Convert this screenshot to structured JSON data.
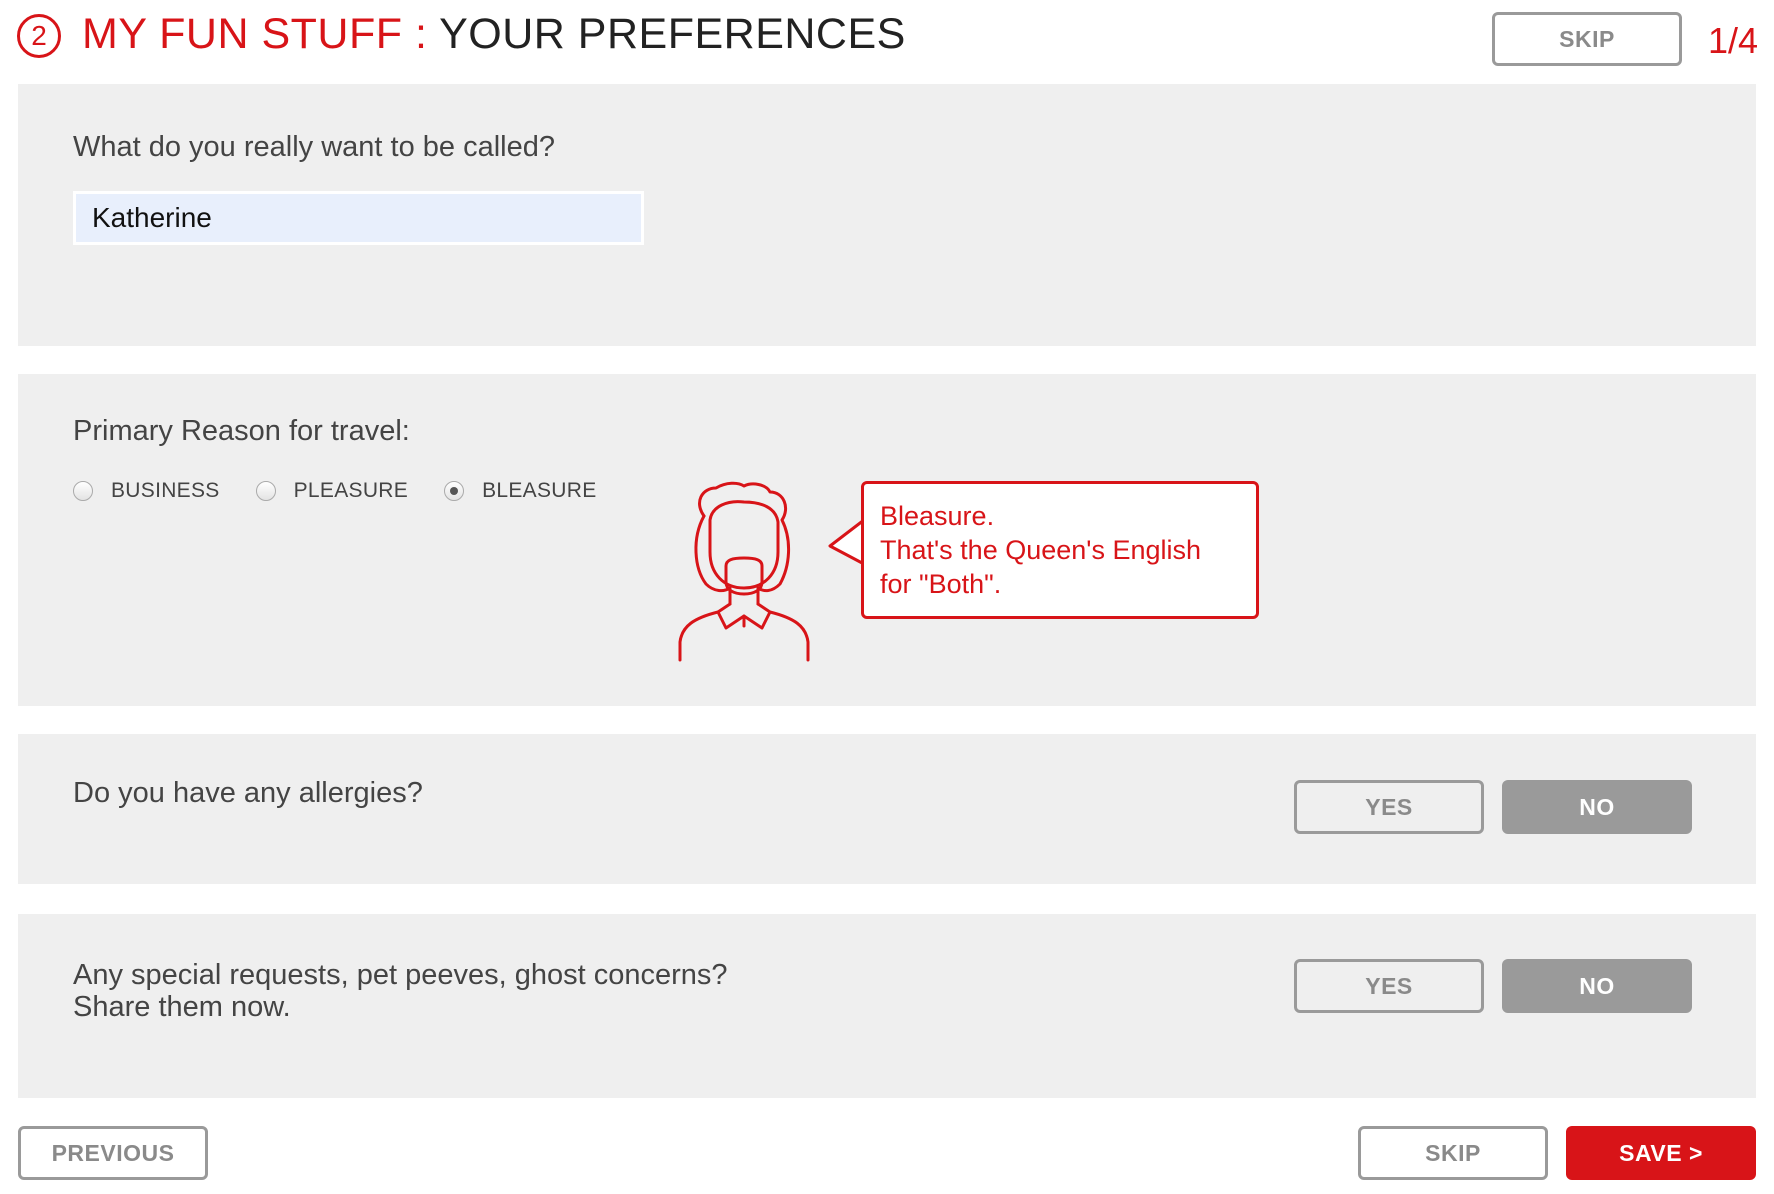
{
  "header": {
    "step_number": "2",
    "title_section": "MY FUN STUFF :",
    "title_page": "YOUR PREFERENCES",
    "skip_label": "SKIP",
    "page_count": "1/4"
  },
  "name_question": {
    "label": "What do you really want to be called?",
    "value": "Katherine"
  },
  "travel_reason": {
    "label": "Primary Reason for travel:",
    "options": [
      {
        "label": "BUSINESS",
        "selected": false
      },
      {
        "label": "PLEASURE",
        "selected": false
      },
      {
        "label": "BLEASURE",
        "selected": true
      }
    ],
    "bubble": {
      "line1": "Bleasure.",
      "line2": "That's the Queen's English",
      "line3": "for \"Both\"."
    }
  },
  "allergies": {
    "label": "Do you have any allergies?",
    "yes_label": "YES",
    "no_label": "NO",
    "selected": "NO"
  },
  "special_requests": {
    "line1": "Any special requests, pet peeves, ghost concerns?",
    "line2": "Share them now.",
    "yes_label": "YES",
    "no_label": "NO",
    "selected": "NO"
  },
  "footer": {
    "previous_label": "PREVIOUS",
    "skip_label": "SKIP",
    "save_label": "SAVE >"
  },
  "colors": {
    "accent_red": "#d81418",
    "panel_bg": "#efefef",
    "grey_button": "#9a9a9a"
  }
}
